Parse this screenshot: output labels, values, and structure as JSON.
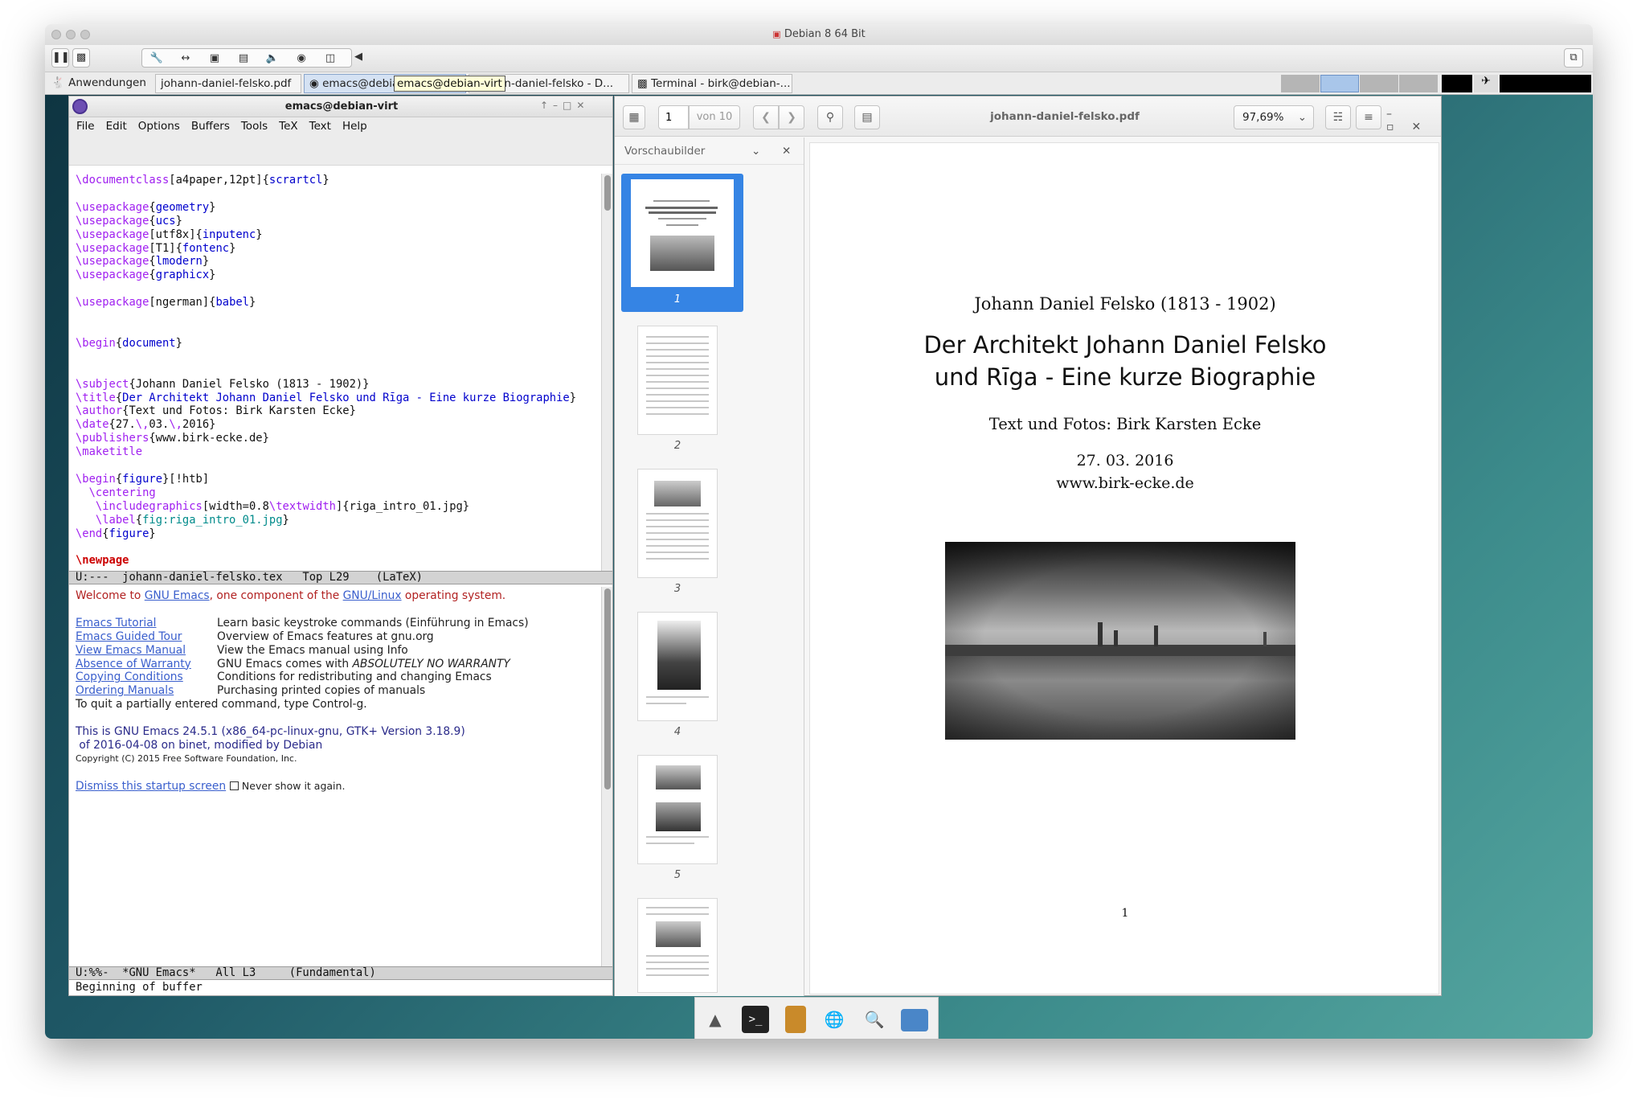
{
  "vm": {
    "title": "Debian 8 64 Bit"
  },
  "panel": {
    "apps": "Anwendungen",
    "tasks": [
      "johann-daniel-felsko.pdf",
      "emacs@debian-virt",
      "johann-daniel-felsko - D...",
      "Terminal - birk@debian-..."
    ],
    "tooltip": "emacs@debian-virt"
  },
  "emacs": {
    "title": "emacs@debian-virt",
    "menu": [
      "File",
      "Edit",
      "Options",
      "Buffers",
      "Tools",
      "TeX",
      "Text",
      "Help"
    ],
    "modeline_top": "U:---  johann-daniel-felsko.tex   Top L29    (LaTeX)",
    "modeline_bottom": "U:%%-  *GNU Emacs*   All L3     (Fundamental)",
    "echo": "Beginning of buffer",
    "welcome": {
      "l1a": "Welcome to ",
      "l1b": "GNU Emacs",
      "l1c": ", one component of the ",
      "l1d": "GNU/Linux",
      "l1e": " operating system.",
      "rows": [
        {
          "link": "Emacs Tutorial",
          "desc": "Learn basic keystroke commands (Einführung in Emacs)"
        },
        {
          "link": "Emacs Guided Tour",
          "desc": "Overview of Emacs features at gnu.org"
        },
        {
          "link": "View Emacs Manual",
          "desc": "View the Emacs manual using Info"
        },
        {
          "link": "Absence of Warranty",
          "desc": "GNU Emacs comes with ",
          "desc_em": "ABSOLUTELY NO WARRANTY"
        },
        {
          "link": "Copying Conditions",
          "desc": "Conditions for redistributing and changing Emacs"
        },
        {
          "link": "Ordering Manuals",
          "desc": "Purchasing printed copies of manuals"
        }
      ],
      "quit": "To quit a partially entered command, type Control-g.",
      "version1": "This is GNU Emacs 24.5.1 (x86_64-pc-linux-gnu, GTK+ Version 3.18.9)",
      "version2": " of 2016-04-08 on binet, modified by Debian",
      "copyright": "Copyright (C) 2015 Free Software Foundation, Inc.",
      "dismiss": "Dismiss this startup screen",
      "never": "Never show it again."
    }
  },
  "viewer": {
    "title": "johann-daniel-felsko.pdf",
    "page_input": "1",
    "page_of": "von 10",
    "zoom": "97,69%",
    "sidebar_label": "Vorschaubilder",
    "thumb_pages": [
      "1",
      "2",
      "3",
      "4",
      "5"
    ],
    "doc": {
      "subject": "Johann Daniel Felsko (1813 - 1902)",
      "title1": "Der Architekt Johann Daniel Felsko",
      "title2": "und Rīga - Eine kurze Biographie",
      "author": "Text und Fotos: Birk Karsten Ecke",
      "date": "27. 03. 2016",
      "publisher": "www.birk-ecke.de",
      "page_number": "1"
    }
  },
  "colors": {
    "selection": "#3584e4",
    "latex_keyword": "#a020f0",
    "latex_arg": "#0000cc"
  }
}
